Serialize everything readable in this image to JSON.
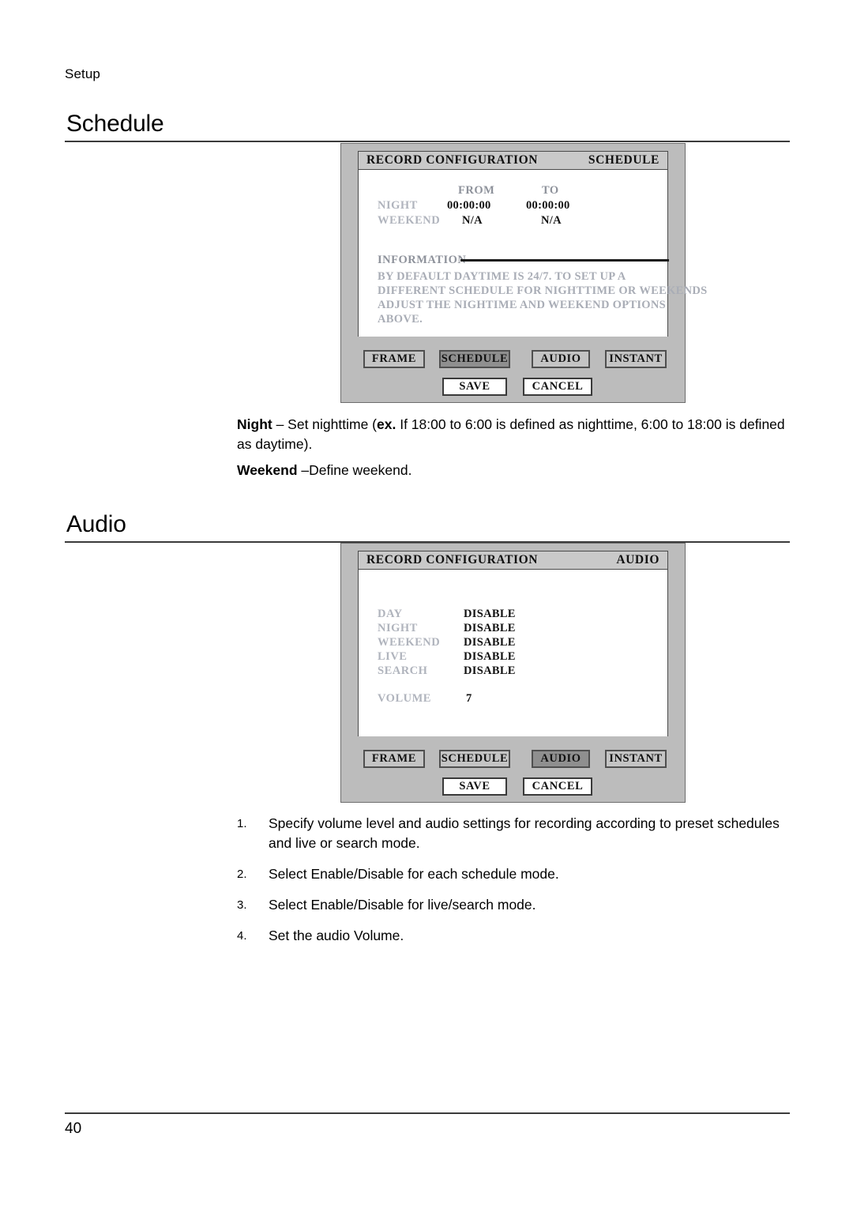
{
  "page": {
    "running_header": "Setup",
    "page_number": "40"
  },
  "sections": [
    {
      "id": "schedule",
      "title": "Schedule"
    },
    {
      "id": "audio",
      "title": "Audio"
    }
  ],
  "schedule_panel": {
    "title": "RECORD CONFIGURATION",
    "mode": "SCHEDULE",
    "columns": {
      "from": "FROM",
      "to": "TO"
    },
    "rows": [
      {
        "label": "NIGHT",
        "from": "00:00:00",
        "to": "00:00:00"
      },
      {
        "label": "WEEKEND",
        "from": "N/A",
        "to": "N/A"
      }
    ],
    "information": {
      "label": "INFORMATION",
      "lines": [
        "BY DEFAULT DAYTIME IS 24/7. TO SET UP A",
        "DIFFERENT SCHEDULE FOR NIGHTTIME OR WEEKENDS",
        "ADJUST THE NIGHTIME AND WEEKEND OPTIONS",
        "ABOVE."
      ]
    },
    "tabs": [
      {
        "label": "FRAME",
        "selected": false
      },
      {
        "label": "SCHEDULE",
        "selected": true
      },
      {
        "label": "AUDIO",
        "selected": false
      },
      {
        "label": "INSTANT",
        "selected": false
      }
    ],
    "actions": [
      {
        "label": "SAVE"
      },
      {
        "label": "CANCEL"
      }
    ]
  },
  "schedule_notes": {
    "night_term": "Night",
    "night_text_1": " – Set nighttime (",
    "night_ex": "ex.",
    "night_text_2": " If 18:00 to 6:00 is defined as nighttime, 6:00 to 18:00",
    "night_text_3": "is defined as daytime).",
    "weekend_term": "Weekend",
    "weekend_text": " –Define weekend."
  },
  "audio_panel": {
    "title": "RECORD CONFIGURATION",
    "mode": "AUDIO",
    "rows": [
      {
        "label": "DAY",
        "value": "DISABLE"
      },
      {
        "label": "NIGHT",
        "value": "DISABLE"
      },
      {
        "label": "WEEKEND",
        "value": "DISABLE"
      },
      {
        "label": "LIVE",
        "value": "DISABLE"
      },
      {
        "label": "SEARCH",
        "value": "DISABLE"
      }
    ],
    "volume": {
      "label": "VOLUME",
      "value": "7"
    },
    "tabs": [
      {
        "label": "FRAME",
        "selected": false
      },
      {
        "label": "SCHEDULE",
        "selected": false
      },
      {
        "label": "AUDIO",
        "selected": true
      },
      {
        "label": "INSTANT",
        "selected": false
      }
    ],
    "actions": [
      {
        "label": "SAVE"
      },
      {
        "label": "CANCEL"
      }
    ]
  },
  "audio_steps": [
    {
      "num": "1.",
      "text": "Specify volume level and audio settings for recording according to preset schedules and live or search mode."
    },
    {
      "num": "2.",
      "text": "Select Enable/Disable for each schedule mode."
    },
    {
      "num": "3.",
      "text": "Select Enable/Disable for live/search mode."
    },
    {
      "num": "4.",
      "text": "Set the audio Volume."
    }
  ]
}
